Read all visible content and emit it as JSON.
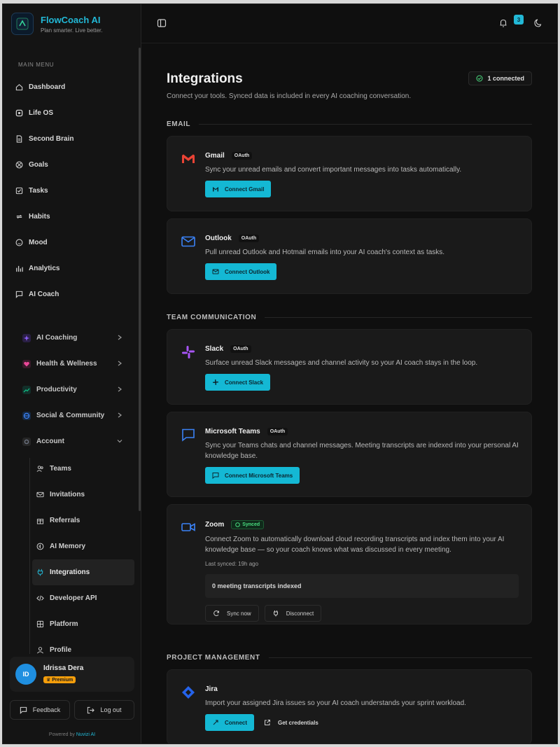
{
  "brand": {
    "name": "FlowCoach AI",
    "tagline": "Plan smarter. Live better."
  },
  "sidebar": {
    "section_label": "MAIN MENU",
    "nav": [
      {
        "label": "Dashboard",
        "icon": "home-icon"
      },
      {
        "label": "Life OS",
        "icon": "layers-icon"
      },
      {
        "label": "Second Brain",
        "icon": "document-icon"
      },
      {
        "label": "Goals",
        "icon": "target-icon"
      },
      {
        "label": "Tasks",
        "icon": "checkbox-icon"
      },
      {
        "label": "Habits",
        "icon": "repeat-icon"
      },
      {
        "label": "Mood",
        "icon": "smile-icon"
      },
      {
        "label": "Analytics",
        "icon": "bar-chart-icon"
      },
      {
        "label": "AI Coach",
        "icon": "chat-icon"
      }
    ],
    "groups": [
      {
        "label": "AI Coaching",
        "color": "#8b5cf6"
      },
      {
        "label": "Health & Wellness",
        "color": "#ec4899"
      },
      {
        "label": "Productivity",
        "color": "#10b981"
      },
      {
        "label": "Social & Community",
        "color": "#3b82f6"
      },
      {
        "label": "Account",
        "color": "#6b7280"
      }
    ],
    "account_items": [
      {
        "label": "Teams",
        "icon": "users-icon"
      },
      {
        "label": "Invitations",
        "icon": "mail-icon"
      },
      {
        "label": "Referrals",
        "icon": "gift-icon"
      },
      {
        "label": "AI Memory",
        "icon": "memory-icon"
      },
      {
        "label": "Integrations",
        "icon": "plug-icon",
        "active": true
      },
      {
        "label": "Developer API",
        "icon": "code-icon"
      },
      {
        "label": "Platform",
        "icon": "grid-icon"
      },
      {
        "label": "Profile",
        "icon": "user-icon"
      }
    ],
    "user": {
      "initials": "ID",
      "name": "Idrissa Dera",
      "plan": "Premium"
    },
    "feedback_label": "Feedback",
    "logout_label": "Log out",
    "powered_prefix": "Powered by",
    "powered_brand": "Nuvizi AI"
  },
  "topbar": {
    "notification_count": "3"
  },
  "main": {
    "title": "Integrations",
    "subtitle": "Connect your tools. Synced data is included in every AI coaching conversation.",
    "connected_label": "1 connected",
    "sections": {
      "email": "EMAIL",
      "team": "TEAM COMMUNICATION",
      "pm": "PROJECT MANAGEMENT"
    },
    "gmail": {
      "name": "Gmail",
      "tag": "OAuth",
      "desc": "Sync your unread emails and convert important messages into tasks automatically.",
      "button": "Connect Gmail"
    },
    "outlook": {
      "name": "Outlook",
      "tag": "OAuth",
      "desc": "Pull unread Outlook and Hotmail emails into your AI coach's context as tasks.",
      "button": "Connect Outlook"
    },
    "slack": {
      "name": "Slack",
      "tag": "OAuth",
      "desc": "Surface unread Slack messages and channel activity so your AI coach stays in the loop.",
      "button": "Connect Slack"
    },
    "teams": {
      "name": "Microsoft Teams",
      "tag": "OAuth",
      "desc": "Sync your Teams chats and channel messages. Meeting transcripts are indexed into your personal AI knowledge base.",
      "button": "Connect Microsoft Teams"
    },
    "zoom": {
      "name": "Zoom",
      "tag": "Synced",
      "desc": "Connect Zoom to automatically download cloud recording transcripts and index them into your AI knowledge base — so your coach knows what was discussed in every meeting.",
      "last_synced": "Last synced: 19h ago",
      "transcripts": "0 meeting transcripts indexed",
      "sync_button": "Sync now",
      "disconnect_button": "Disconnect"
    },
    "jira": {
      "name": "Jira",
      "desc": "Import your assigned Jira issues so your AI coach understands your sprint workload.",
      "button": "Connect",
      "credentials": "Get credentials"
    }
  },
  "colors": {
    "accent": "#14b8d4",
    "premium": "#f59e0b",
    "synced": "#4ade80"
  }
}
